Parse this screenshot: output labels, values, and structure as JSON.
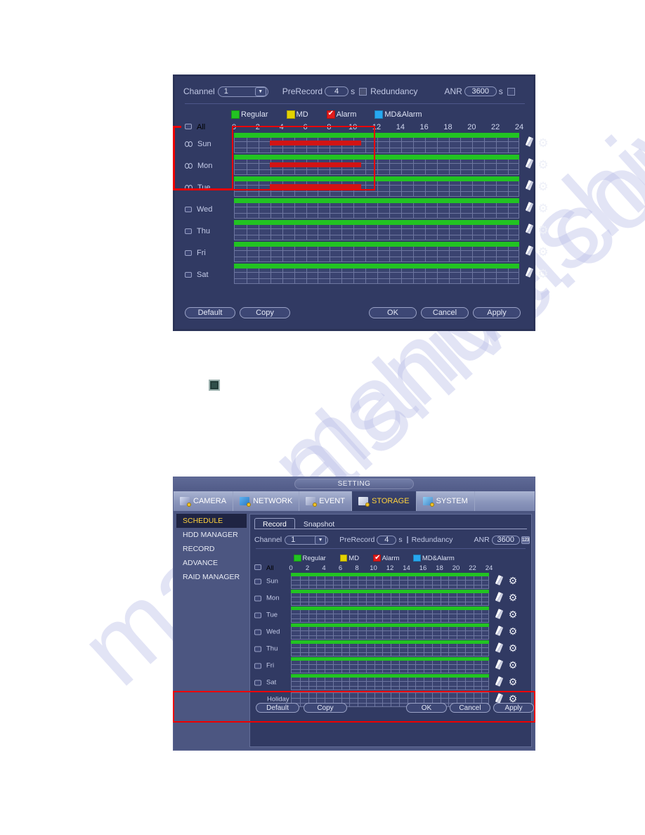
{
  "watermark": {
    "line1": "manualshive.com",
    "line2": "manualshive.com"
  },
  "fig1": {
    "channel_label": "Channel",
    "channel_value": "1",
    "prerecord_label": "PreRecord",
    "prerecord_value": "4",
    "prerecord_unit": "s",
    "redundancy_label": "Redundancy",
    "anr_label": "ANR",
    "anr_value": "3600",
    "anr_unit": "s",
    "legend": [
      {
        "name": "Regular",
        "color": "#22c322",
        "checked": false
      },
      {
        "name": "MD",
        "color": "#e3d200",
        "checked": false
      },
      {
        "name": "Alarm",
        "color": "#e01b1b",
        "checked": true
      },
      {
        "name": "MD&Alarm",
        "color": "#27a8f0",
        "checked": false
      }
    ],
    "hours": [
      "0",
      "2",
      "4",
      "6",
      "8",
      "10",
      "12",
      "14",
      "16",
      "18",
      "20",
      "22",
      "24"
    ],
    "all_label": "All",
    "rows": [
      {
        "day": "Sun",
        "linked": true,
        "green": {
          "start": 0.0,
          "end": 24.0
        },
        "red": {
          "start": 3.0,
          "end": 10.7
        }
      },
      {
        "day": "Mon",
        "linked": true,
        "green": {
          "start": 0.0,
          "end": 24.0
        },
        "red": {
          "start": 3.0,
          "end": 10.7
        }
      },
      {
        "day": "Tue",
        "linked": true,
        "green": {
          "start": 0.0,
          "end": 24.0
        },
        "red": {
          "start": 3.0,
          "end": 10.7
        }
      },
      {
        "day": "Wed",
        "linked": false,
        "green": {
          "start": 0.0,
          "end": 24.0
        },
        "red": null
      },
      {
        "day": "Thu",
        "linked": false,
        "green": {
          "start": 0.0,
          "end": 24.0
        },
        "red": null
      },
      {
        "day": "Fri",
        "linked": false,
        "green": {
          "start": 0.0,
          "end": 24.0
        },
        "red": null
      },
      {
        "day": "Sat",
        "linked": false,
        "green": {
          "start": 0.0,
          "end": 24.0
        },
        "red": null
      }
    ],
    "buttons": {
      "default": "Default",
      "copy": "Copy",
      "ok": "OK",
      "cancel": "Cancel",
      "apply": "Apply"
    },
    "icons": {
      "erase": "eraser-icon",
      "gear": "gear-icon"
    }
  },
  "fig2": {
    "title": "SETTING",
    "main_tabs": [
      {
        "label": "CAMERA",
        "icon": "camera-icon",
        "active": false
      },
      {
        "label": "NETWORK",
        "icon": "network-icon",
        "active": false
      },
      {
        "label": "EVENT",
        "icon": "event-icon",
        "active": false
      },
      {
        "label": "STORAGE",
        "icon": "storage-icon",
        "active": true
      },
      {
        "label": "SYSTEM",
        "icon": "system-icon",
        "active": false
      }
    ],
    "sidebar": [
      {
        "label": "SCHEDULE",
        "active": true
      },
      {
        "label": "HDD MANAGER",
        "active": false
      },
      {
        "label": "RECORD",
        "active": false
      },
      {
        "label": "ADVANCE",
        "active": false
      },
      {
        "label": "RAID MANAGER",
        "active": false
      }
    ],
    "sub_tabs": [
      {
        "label": "Record",
        "active": true
      },
      {
        "label": "Snapshot",
        "active": false
      }
    ],
    "channel_label": "Channel",
    "channel_value": "1",
    "prerecord_label": "PreRecord",
    "prerecord_value": "4",
    "prerecord_unit": "s",
    "redundancy_label": "Redundancy",
    "anr_label": "ANR",
    "anr_value": "3600",
    "anr_keypad": "123",
    "legend": [
      {
        "name": "Regular",
        "color": "#22c322",
        "checked": false
      },
      {
        "name": "MD",
        "color": "#e3d200",
        "checked": false
      },
      {
        "name": "Alarm",
        "color": "#e01b1b",
        "checked": true
      },
      {
        "name": "MD&Alarm",
        "color": "#27a8f0",
        "checked": false
      }
    ],
    "hours": [
      "0",
      "2",
      "4",
      "6",
      "8",
      "10",
      "12",
      "14",
      "16",
      "18",
      "20",
      "22",
      "24"
    ],
    "all_label": "All",
    "rows": [
      {
        "day": "Sun",
        "checkbox": true,
        "green": {
          "start": 0.0,
          "end": 24.0
        }
      },
      {
        "day": "Mon",
        "checkbox": true,
        "green": {
          "start": 0.0,
          "end": 24.0
        }
      },
      {
        "day": "Tue",
        "checkbox": true,
        "green": {
          "start": 0.0,
          "end": 24.0
        }
      },
      {
        "day": "Wed",
        "checkbox": true,
        "green": {
          "start": 0.0,
          "end": 24.0
        }
      },
      {
        "day": "Thu",
        "checkbox": true,
        "green": {
          "start": 0.0,
          "end": 24.0
        }
      },
      {
        "day": "Fri",
        "checkbox": true,
        "green": {
          "start": 0.0,
          "end": 24.0
        }
      },
      {
        "day": "Sat",
        "checkbox": true,
        "green": {
          "start": 0.0,
          "end": 24.0
        }
      },
      {
        "day": "Holiday",
        "checkbox": false,
        "green": null
      }
    ],
    "buttons": {
      "default": "Default",
      "copy": "Copy",
      "ok": "OK",
      "cancel": "Cancel",
      "apply": "Apply"
    },
    "icons": {
      "erase": "eraser-icon",
      "gear": "gear-icon"
    }
  },
  "colors": {
    "panel_bg": "#313a63",
    "frame": "#4c5681",
    "accent_yellow": "#ffd23c",
    "annotation_red": "#ee0000",
    "green_bar": "#22c322",
    "red_bar": "#d21414"
  }
}
